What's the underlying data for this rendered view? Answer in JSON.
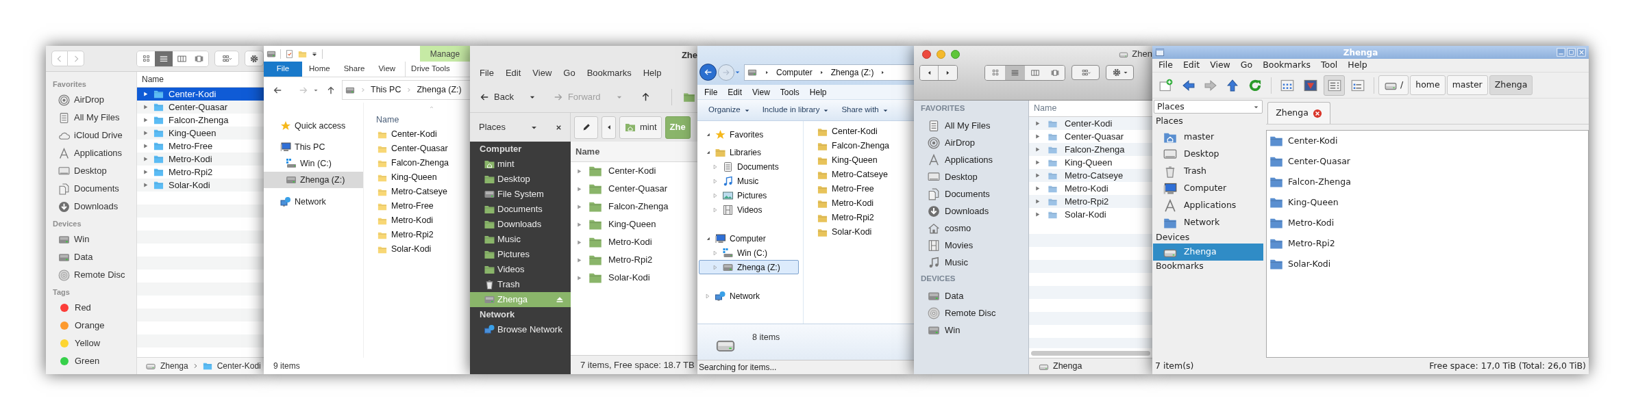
{
  "windows": [
    {
      "kind": "finder_sierra",
      "sidebar": [
        {
          "heading": "Favorites",
          "items": [
            {
              "label": "AirDrop"
            },
            {
              "label": "All My Files"
            },
            {
              "label": "iCloud Drive"
            },
            {
              "label": "Applications"
            },
            {
              "label": "Desktop"
            },
            {
              "label": "Documents"
            },
            {
              "label": "Downloads"
            }
          ]
        },
        {
          "heading": "Devices",
          "items": [
            {
              "label": "Win"
            },
            {
              "label": "Data"
            },
            {
              "label": "Remote Disc"
            }
          ]
        },
        {
          "heading": "Tags",
          "items": [
            {
              "label": "Red",
              "color": "#fc3d39"
            },
            {
              "label": "Orange",
              "color": "#fd9a2f"
            },
            {
              "label": "Yellow",
              "color": "#fdd531"
            },
            {
              "label": "Green",
              "color": "#36d04a"
            }
          ]
        }
      ],
      "column": "Name",
      "files": [
        {
          "name": "Center-Kodi",
          "selected": true
        },
        {
          "name": "Center-Quasar",
          "selected": false
        },
        {
          "name": "Falcon-Zhenga",
          "selected": false
        },
        {
          "name": "King-Queen",
          "selected": false
        },
        {
          "name": "Metro-Free",
          "selected": false
        },
        {
          "name": "Metro-Kodi",
          "selected": false
        },
        {
          "name": "Metro-Rpi2",
          "selected": false
        },
        {
          "name": "Solar-Kodi",
          "selected": false
        }
      ],
      "path": [
        "Zhenga",
        "Center-Kodi"
      ]
    },
    {
      "kind": "explorer10",
      "context_tab": "Manage",
      "ribbon_tabs": [
        {
          "label": "File",
          "kind": "menu"
        },
        {
          "label": "Home",
          "kind": "tab"
        },
        {
          "label": "Share",
          "kind": "tab"
        },
        {
          "label": "View",
          "kind": "tab"
        },
        {
          "label": "Drive Tools",
          "kind": "context"
        }
      ],
      "address": [
        "This PC",
        "Zhenga (Z:)"
      ],
      "nav": [
        {
          "label": "Quick access",
          "selected": false
        },
        {
          "label": "This PC",
          "selected": false,
          "children": [
            {
              "label": "Win (C:)",
              "selected": false
            },
            {
              "label": "Zhenga (Z:)",
              "selected": true
            }
          ]
        },
        {
          "label": "Network",
          "selected": false
        }
      ],
      "column": "Name",
      "files": [
        {
          "name": "Center-Kodi",
          "selected": false
        },
        {
          "name": "Center-Quasar",
          "selected": false
        },
        {
          "name": "Falcon-Zhenga",
          "selected": false
        },
        {
          "name": "King-Queen",
          "selected": false
        },
        {
          "name": "Metro-Catseye",
          "selected": false
        },
        {
          "name": "Metro-Free",
          "selected": false
        },
        {
          "name": "Metro-Kodi",
          "selected": false
        },
        {
          "name": "Metro-Rpi2",
          "selected": false
        },
        {
          "name": "Solar-Kodi",
          "selected": false
        }
      ],
      "status": "9 items"
    },
    {
      "kind": "nemo",
      "title": "Zhe",
      "menu": [
        "File",
        "Edit",
        "View",
        "Go",
        "Bookmarks",
        "Help"
      ],
      "toolbar": [
        {
          "label": "Back",
          "disabled": false
        },
        {
          "label": "Forward",
          "disabled": true
        }
      ],
      "pane_selector": "Places",
      "breadcrumbs": [
        {
          "label": "mint",
          "selected": false
        },
        {
          "label": "Zhe",
          "selected": true
        }
      ],
      "sidebar": [
        {
          "heading": "Computer",
          "items": [
            {
              "label": "mint",
              "selected": false
            },
            {
              "label": "Desktop",
              "selected": false
            },
            {
              "label": "File System",
              "selected": false
            },
            {
              "label": "Documents",
              "selected": false
            },
            {
              "label": "Downloads",
              "selected": false
            },
            {
              "label": "Music",
              "selected": false
            },
            {
              "label": "Pictures",
              "selected": false
            },
            {
              "label": "Videos",
              "selected": false
            },
            {
              "label": "Trash",
              "selected": false
            },
            {
              "label": "Zhenga",
              "selected": true
            }
          ]
        },
        {
          "heading": "Network",
          "items": [
            {
              "label": "Browse Network",
              "selected": false
            }
          ]
        }
      ],
      "column": "Name",
      "files": [
        {
          "name": "Center-Kodi",
          "selected": false
        },
        {
          "name": "Center-Quasar",
          "selected": false
        },
        {
          "name": "Falcon-Zhenga",
          "selected": false
        },
        {
          "name": "King-Queen",
          "selected": false
        },
        {
          "name": "Metro-Kodi",
          "selected": false
        },
        {
          "name": "Metro-Rpi2",
          "selected": false
        },
        {
          "name": "Solar-Kodi",
          "selected": false
        }
      ],
      "status": "7 items, Free space: 18.7 TB"
    },
    {
      "kind": "explorer7",
      "address": [
        "Computer",
        "Zhenga (Z:)"
      ],
      "menu": [
        "File",
        "Edit",
        "View",
        "Tools",
        "Help"
      ],
      "commands": [
        "Organize",
        "Include in library",
        "Share with"
      ],
      "nav": [
        {
          "label": "Favorites",
          "selected": false,
          "expanded": true
        },
        {
          "label": "Libraries",
          "selected": false,
          "expanded": true,
          "children": [
            {
              "label": "Documents",
              "selected": false,
              "expanded": false
            },
            {
              "label": "Music",
              "selected": false,
              "expanded": false
            },
            {
              "label": "Pictures",
              "selected": false,
              "expanded": false
            },
            {
              "label": "Videos",
              "selected": false,
              "expanded": false
            }
          ]
        },
        {
          "label": "Computer",
          "selected": false,
          "expanded": true,
          "children": [
            {
              "label": "Win (C:)",
              "selected": false,
              "expanded": false
            },
            {
              "label": "Zhenga (Z:)",
              "selected": true,
              "expanded": false
            }
          ]
        },
        {
          "label": "Network",
          "selected": false,
          "expanded": false
        }
      ],
      "files": [
        {
          "name": "Center-Kodi",
          "selected": false
        },
        {
          "name": "Falcon-Zhenga",
          "selected": false
        },
        {
          "name": "King-Queen",
          "selected": false
        },
        {
          "name": "Metro-Catseye",
          "selected": false
        },
        {
          "name": "Metro-Free",
          "selected": false
        },
        {
          "name": "Metro-Kodi",
          "selected": false
        },
        {
          "name": "Metro-Rpi2",
          "selected": false
        },
        {
          "name": "Solar-Kodi",
          "selected": false
        }
      ],
      "details": "8 items",
      "status": "Searching for items..."
    },
    {
      "kind": "finder_lion",
      "title": "Zhen",
      "sidebar": [
        {
          "heading": "FAVORITES",
          "items": [
            {
              "label": "All My Files"
            },
            {
              "label": "AirDrop"
            },
            {
              "label": "Applications"
            },
            {
              "label": "Desktop"
            },
            {
              "label": "Documents"
            },
            {
              "label": "Downloads"
            },
            {
              "label": "cosmo"
            },
            {
              "label": "Movies"
            },
            {
              "label": "Music"
            }
          ]
        },
        {
          "heading": "DEVICES",
          "items": [
            {
              "label": "Data"
            },
            {
              "label": "Remote Disc"
            },
            {
              "label": "Win"
            }
          ]
        }
      ],
      "column": "Name",
      "files": [
        {
          "name": "Center-Kodi",
          "selected": false
        },
        {
          "name": "Center-Quasar",
          "selected": false
        },
        {
          "name": "Falcon-Zhenga",
          "selected": false
        },
        {
          "name": "King-Queen",
          "selected": false
        },
        {
          "name": "Metro-Catseye",
          "selected": false
        },
        {
          "name": "Metro-Kodi",
          "selected": false
        },
        {
          "name": "Metro-Rpi2",
          "selected": false
        },
        {
          "name": "Solar-Kodi",
          "selected": false
        }
      ],
      "path": [
        "Zhenga"
      ]
    },
    {
      "kind": "pcmanfm",
      "title": "Zhenga",
      "menu": [
        "File",
        "Edit",
        "View",
        "Go",
        "Bookmarks",
        "Tool",
        "Help"
      ],
      "path_buttons": [
        {
          "label": "/",
          "selected": false
        },
        {
          "label": "home",
          "selected": false
        },
        {
          "label": "master",
          "selected": false
        },
        {
          "label": "Zhenga",
          "selected": true
        }
      ],
      "pane_selector": "Places",
      "sidebar": [
        {
          "heading": "Places",
          "items": [
            {
              "label": "master",
              "selected": false
            },
            {
              "label": "Desktop",
              "selected": false
            },
            {
              "label": "Trash",
              "selected": false
            },
            {
              "label": "Computer",
              "selected": false
            },
            {
              "label": "Applications",
              "selected": false
            },
            {
              "label": "Network",
              "selected": false
            }
          ]
        },
        {
          "heading": "Devices",
          "items": [
            {
              "label": "Zhenga",
              "selected": true
            }
          ]
        },
        {
          "heading": "Bookmarks"
        }
      ],
      "tab": "Zhenga",
      "files": [
        {
          "name": "Center-Kodi",
          "selected": false
        },
        {
          "name": "Center-Quasar",
          "selected": false
        },
        {
          "name": "Falcon-Zhenga",
          "selected": false
        },
        {
          "name": "King-Queen",
          "selected": false
        },
        {
          "name": "Metro-Kodi",
          "selected": false
        },
        {
          "name": "Metro-Rpi2",
          "selected": false
        },
        {
          "name": "Solar-Kodi",
          "selected": false
        }
      ],
      "status_left": "7 item(s)",
      "status_right": "Free space: 17,0 TiB (Total: 26,0 TiB)"
    }
  ]
}
